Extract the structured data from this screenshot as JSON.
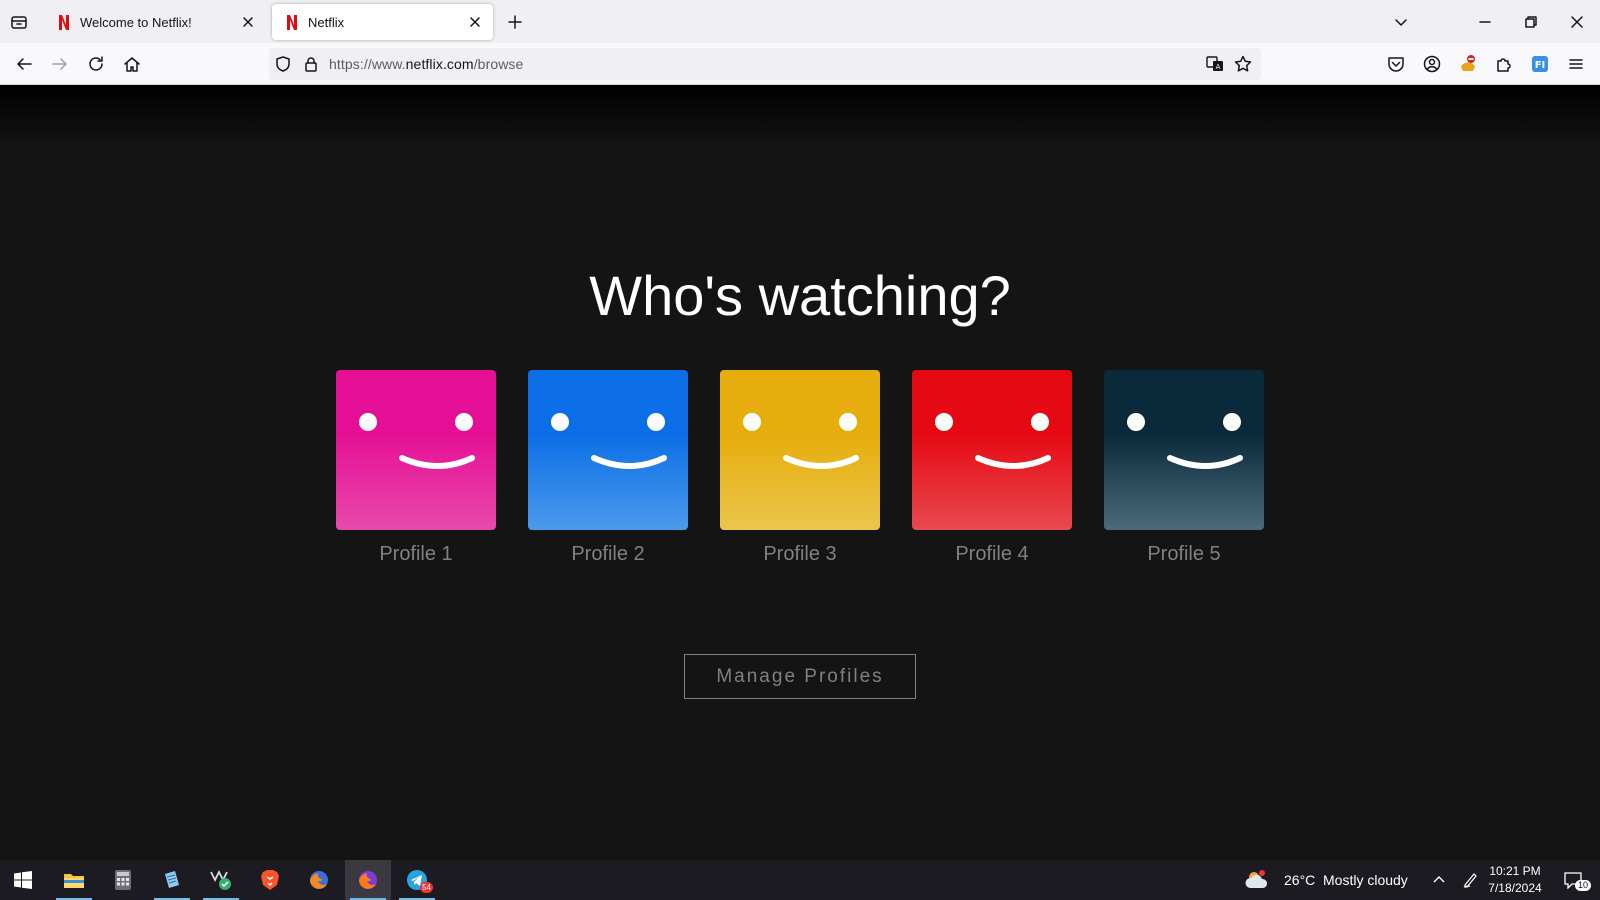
{
  "browser": {
    "tabs": [
      {
        "title": "Welcome to Netflix!",
        "active": false
      },
      {
        "title": "Netflix",
        "active": true
      }
    ],
    "url": {
      "prefix": "https://www.",
      "domain": "netflix.com",
      "path": "/browse"
    }
  },
  "page": {
    "heading": "Who's watching?",
    "profiles": [
      {
        "name": "Profile 1",
        "top": "#e50f96",
        "bottom": "#e84aa9"
      },
      {
        "name": "Profile 2",
        "top": "#0b6ee6",
        "bottom": "#4c9aeb"
      },
      {
        "name": "Profile 3",
        "top": "#e6ad0c",
        "bottom": "#eac64c"
      },
      {
        "name": "Profile 4",
        "top": "#e50914",
        "bottom": "#e8494f"
      },
      {
        "name": "Profile 5",
        "top": "#0a2a3c",
        "bottom": "#4b6b7b"
      }
    ],
    "manage_label": "Manage Profiles"
  },
  "taskbar": {
    "weather_temp": "26°C",
    "weather_text": "Mostly cloudy",
    "time": "10:21 PM",
    "date": "7/18/2024",
    "telegram_badge": "54",
    "notification_count": "10"
  },
  "colors": {
    "netflix_red": "#e50914",
    "page_bg": "#141414"
  }
}
